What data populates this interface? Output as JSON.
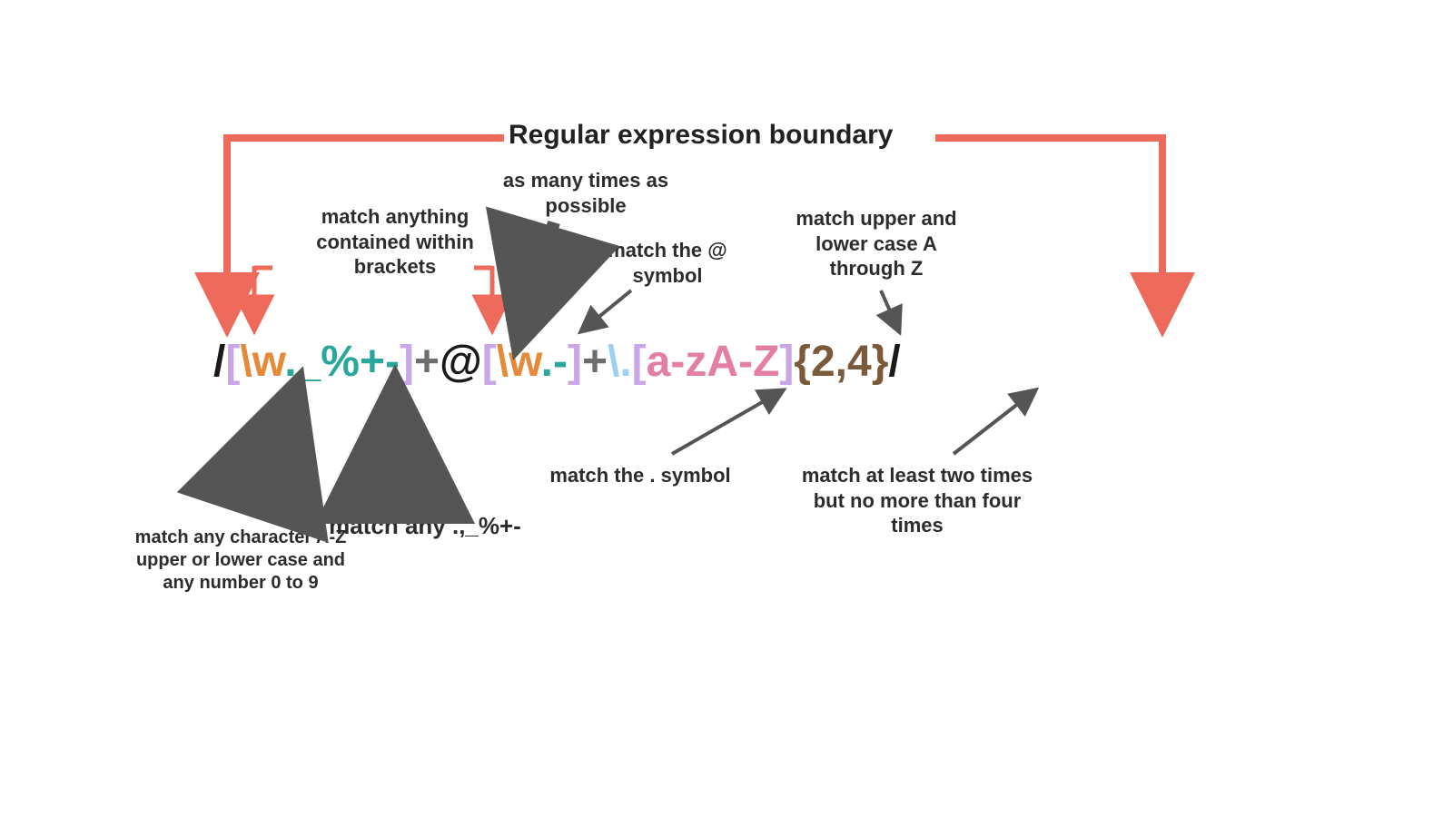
{
  "title": "Regular expression boundary",
  "regex": {
    "slash1": "/",
    "lb1": "[",
    "bw1": "\\w",
    "grp1rest": "._%+-",
    "rb1": "]",
    "plus1": "+",
    "at": "@",
    "lb2": "[",
    "bw2": "\\w",
    "grp2rest": ".-",
    "rb2": "]",
    "plus2": "+",
    "escdot": "\\.",
    "lb3": "[",
    "class3": "a-zA-Z",
    "rb3": "]",
    "quant": "{2,4}",
    "slash2": "/"
  },
  "annotations": {
    "brackets": "match anything contained within brackets",
    "plus": "as many times as possible",
    "at": "match the @ symbol",
    "az": "match upper and lower case A through Z",
    "word": "match any character A-Z upper or lower case and any number 0 to 9",
    "punct": "match any .,_%+-",
    "dot": "match the .  symbol",
    "quant": "match at least two times but no more than four times"
  },
  "colors": {
    "salmon": "#ee6a5b",
    "arrow": "#555555"
  }
}
